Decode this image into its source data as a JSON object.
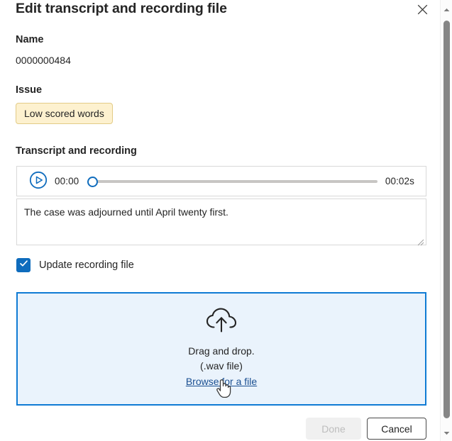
{
  "dialog": {
    "title": "Edit transcript and recording file",
    "close_icon": "close-icon"
  },
  "name_section": {
    "label": "Name",
    "value": "0000000484"
  },
  "issue_section": {
    "label": "Issue",
    "badge": "Low scored words",
    "badge_bg": "#fdf1cf",
    "badge_border": "#e3cb86"
  },
  "transcript_section": {
    "label": "Transcript and recording",
    "player": {
      "play_icon": "play-icon",
      "current_time": "00:00",
      "total_time": "00:02s",
      "progress_percent": 0,
      "accent": "#0f6cbd",
      "track_color": "#c8c6c4"
    },
    "transcript_text": "The case was adjourned until April twenty first."
  },
  "update_recording": {
    "label": "Update recording file",
    "checked": true,
    "check_icon": "checkmark-icon",
    "accent": "#0f6cbd"
  },
  "dropzone": {
    "icon": "cloud-upload-icon",
    "line1": "Drag and drop.",
    "line2": "(.wav file)",
    "link": "Browse for a file",
    "border_color": "#0f7bd4",
    "background": "#eaf3fc"
  },
  "footer": {
    "done_label": "Done",
    "done_disabled": true,
    "cancel_label": "Cancel"
  },
  "scrollbar": {
    "up_arrow_icon": "chevron-up-icon",
    "down_arrow_icon": "chevron-down-icon"
  },
  "cursor": {
    "type": "pointing-hand-cursor"
  }
}
